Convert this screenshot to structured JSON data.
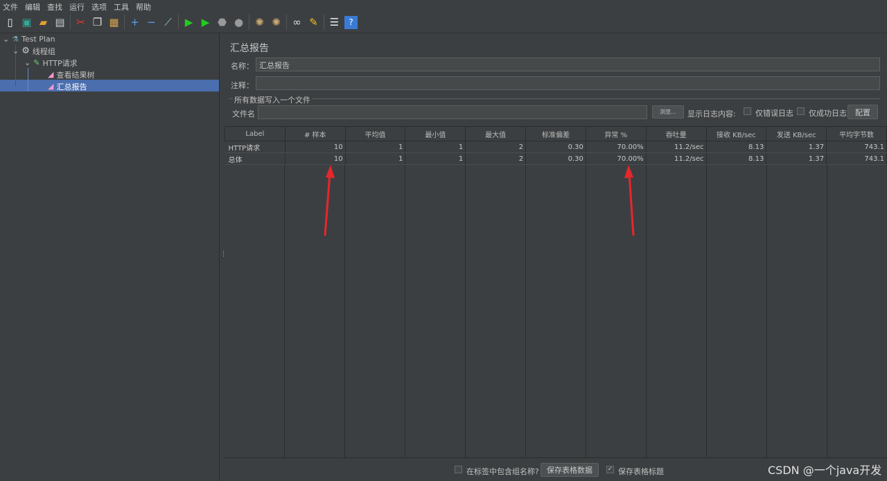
{
  "menu": [
    "文件",
    "编辑",
    "查找",
    "运行",
    "选项",
    "工具",
    "帮助"
  ],
  "toolbar_icons": [
    "new-icon",
    "templates-icon",
    "open-icon",
    "save-icon",
    "cut-icon",
    "copy-icon",
    "paste-icon",
    "expand-icon",
    "collapse-icon",
    "toggle-icon",
    "start-icon",
    "start-no-pause-icon",
    "stop-icon",
    "shutdown-icon",
    "clear-icon",
    "clear-all-icon",
    "search-icon",
    "reset-search-icon",
    "function-helper-icon",
    "help-icon"
  ],
  "tree": {
    "test_plan": "Test Plan",
    "thread_group": "线程组",
    "http_request": "HTTP请求",
    "view_results_tree": "查看结果树",
    "summary_report": "汇总报告"
  },
  "panel": {
    "title": "汇总报告",
    "name_label": "名称：",
    "name_value": "汇总报告",
    "comment_label": "注释：",
    "comment_value": "",
    "group_title": "所有数据写入一个文件",
    "filename_label": "文件名",
    "filename_value": "",
    "browse": "浏览...",
    "log_label": "显示日志内容:",
    "errors_only": "仅错误日志",
    "success_only": "仅成功日志",
    "configure": "配置"
  },
  "table": {
    "headers": [
      "Label",
      "# 样本",
      "平均值",
      "最小值",
      "最大值",
      "标准偏差",
      "异常 %",
      "吞吐量",
      "接收 KB/sec",
      "发送 KB/sec",
      "平均字节数"
    ],
    "rows": [
      [
        "HTTP请求",
        "10",
        "1",
        "1",
        "2",
        "0.30",
        "70.00%",
        "11.2/sec",
        "8.13",
        "1.37",
        "743.1"
      ],
      [
        "总体",
        "10",
        "1",
        "1",
        "2",
        "0.30",
        "70.00%",
        "11.2/sec",
        "8.13",
        "1.37",
        "743.1"
      ]
    ]
  },
  "bottom": {
    "include_group": "在标签中包含组名称?",
    "include_group_checked": false,
    "save_data": "保存表格数据",
    "save_header": "保存表格标题",
    "save_header_checked": true
  },
  "watermark": "CSDN @一个java开发",
  "colors": {
    "selection": "#4b6eaf",
    "annotation_arrow": "#e8262b"
  }
}
